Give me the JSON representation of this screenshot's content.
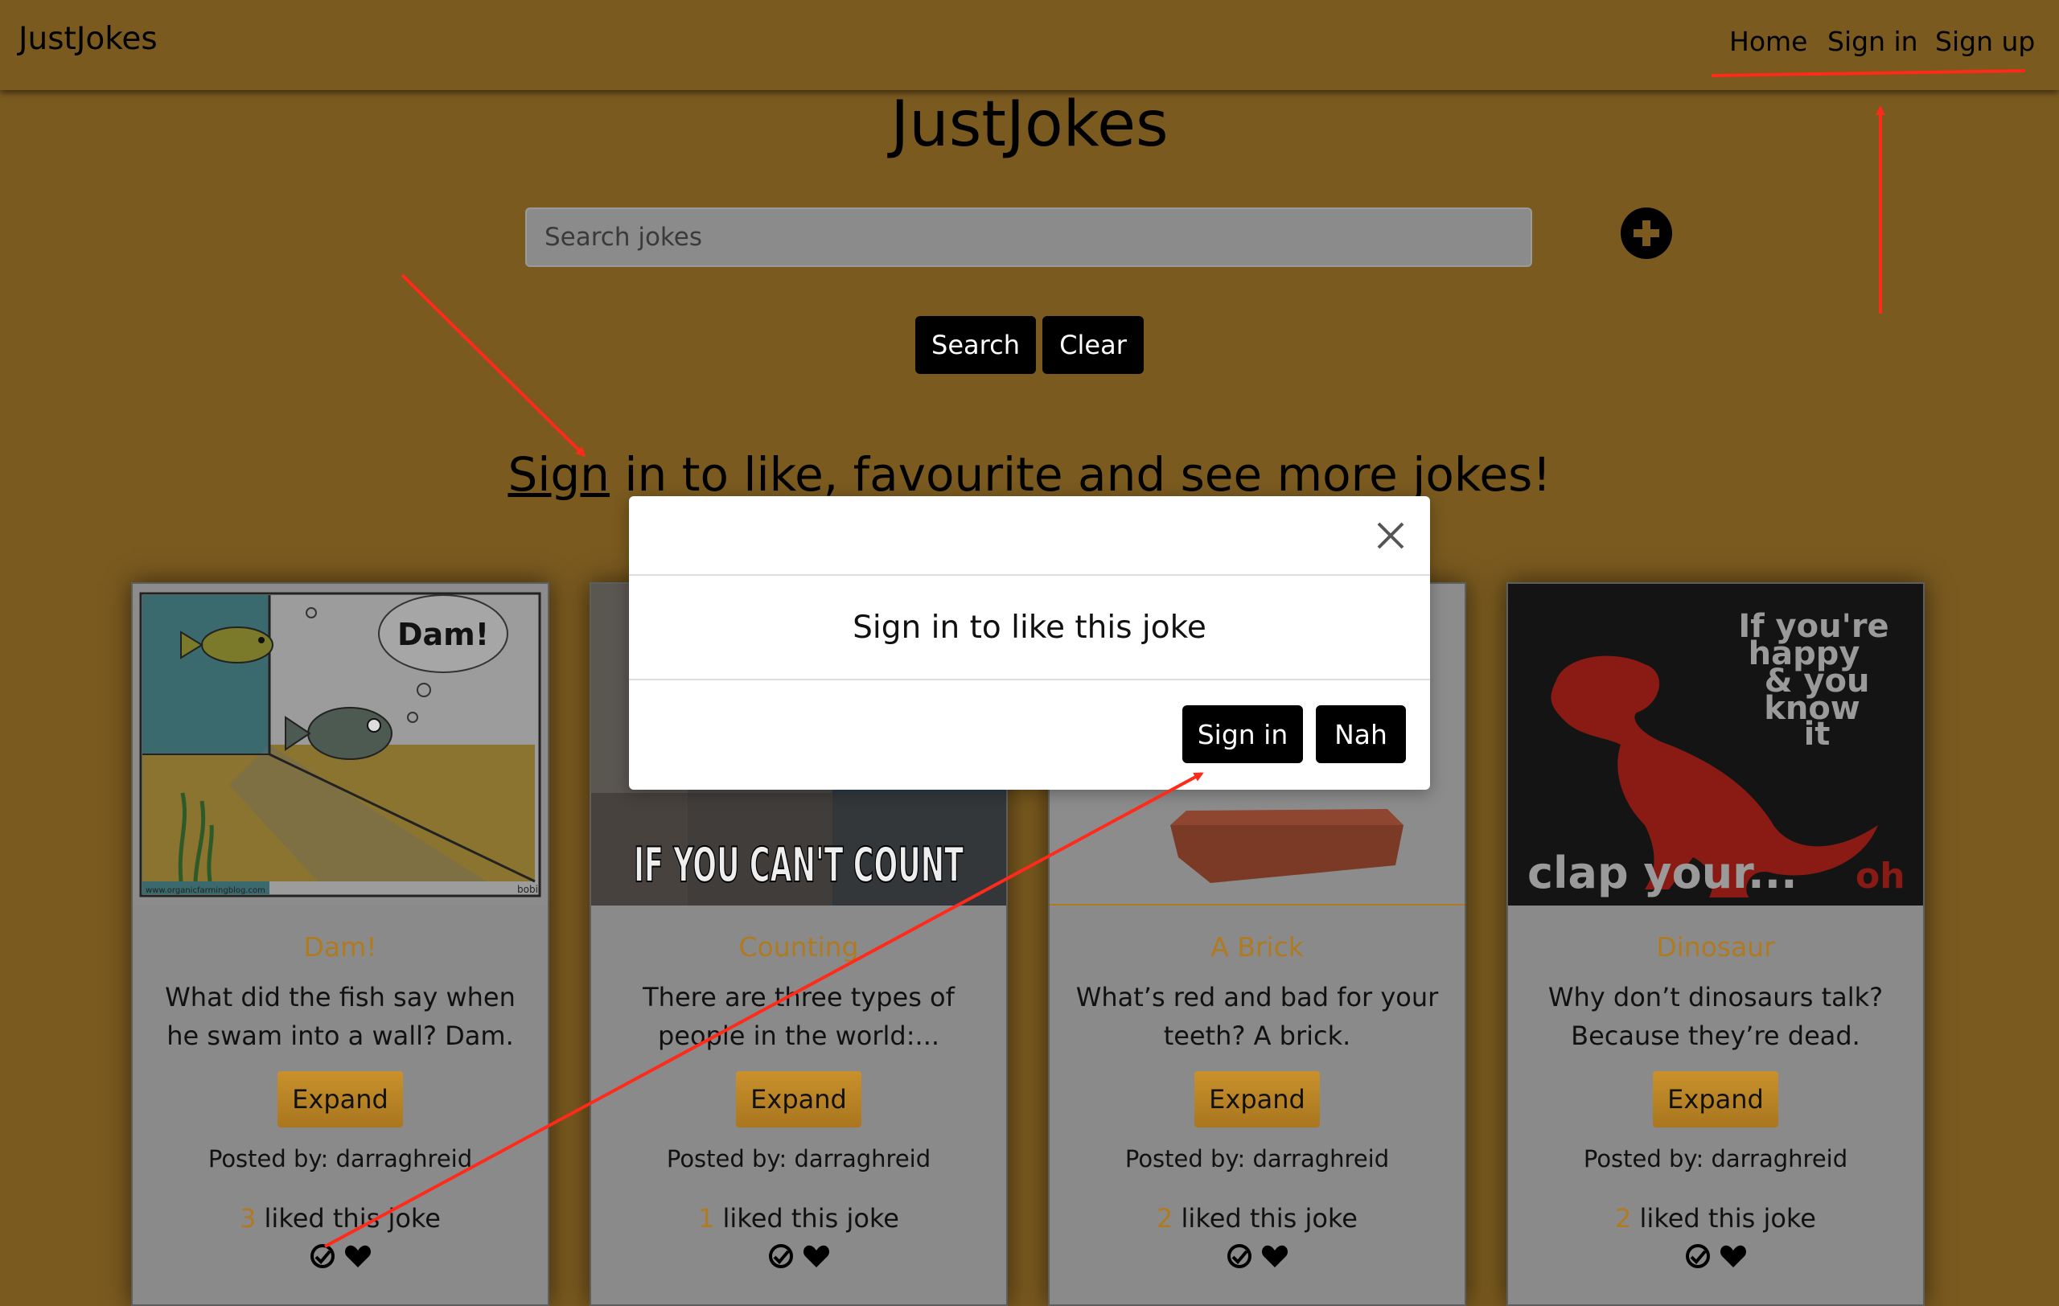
{
  "navbar": {
    "brand": "JustJokes",
    "links": [
      "Home",
      "Sign in",
      "Sign up"
    ]
  },
  "main": {
    "title": "JustJokes",
    "search_placeholder": "Search jokes",
    "add_icon": "plus-circle-icon",
    "search_label": "Search",
    "clear_label": "Clear",
    "signin_prompt_link": "Sign",
    "signin_prompt_rest": " in to like, favourite and see more jokes!"
  },
  "cards": [
    {
      "title": "Dam!",
      "text": "What did the fish say when he swam into a wall? Dam.",
      "image_text": "Dam!",
      "image_caption_left": "www.organicfarmingblog.com",
      "image_caption_right": "bobi",
      "expand_label": "Expand",
      "posted_by": "Posted by: darraghreid",
      "like_count": "3",
      "like_text": " liked this joke"
    },
    {
      "title": "Counting",
      "text": "There are three types of people in the world:...",
      "image_text": "IF YOU CAN'T COUNT",
      "expand_label": "Expand",
      "posted_by": "Posted by: darraghreid",
      "like_count": "1",
      "like_text": " liked this joke"
    },
    {
      "title": "A Brick",
      "text": "What’s red and bad for your teeth? A brick.",
      "expand_label": "Expand",
      "posted_by": "Posted by: darraghreid",
      "like_count": "2",
      "like_text": " liked this joke"
    },
    {
      "title": "Dinosaur",
      "text": "Why don’t dinosaurs talk? Because they’re dead.",
      "image_text_lines": [
        "If you're",
        "happy",
        "& you",
        "know",
        "it"
      ],
      "image_bottom": "clap your...",
      "image_bottom_oh": "oh",
      "expand_label": "Expand",
      "posted_by": "Posted by: darraghreid",
      "like_count": "2",
      "like_text": " liked this joke"
    }
  ],
  "modal": {
    "message": "Sign in to like this joke",
    "signin_label": "Sign in",
    "nah_label": "Nah",
    "close_icon": "close-icon"
  },
  "colors": {
    "background": "#7a5a1f",
    "accent": "#b07a20",
    "annotation": "#ff2a1a"
  }
}
